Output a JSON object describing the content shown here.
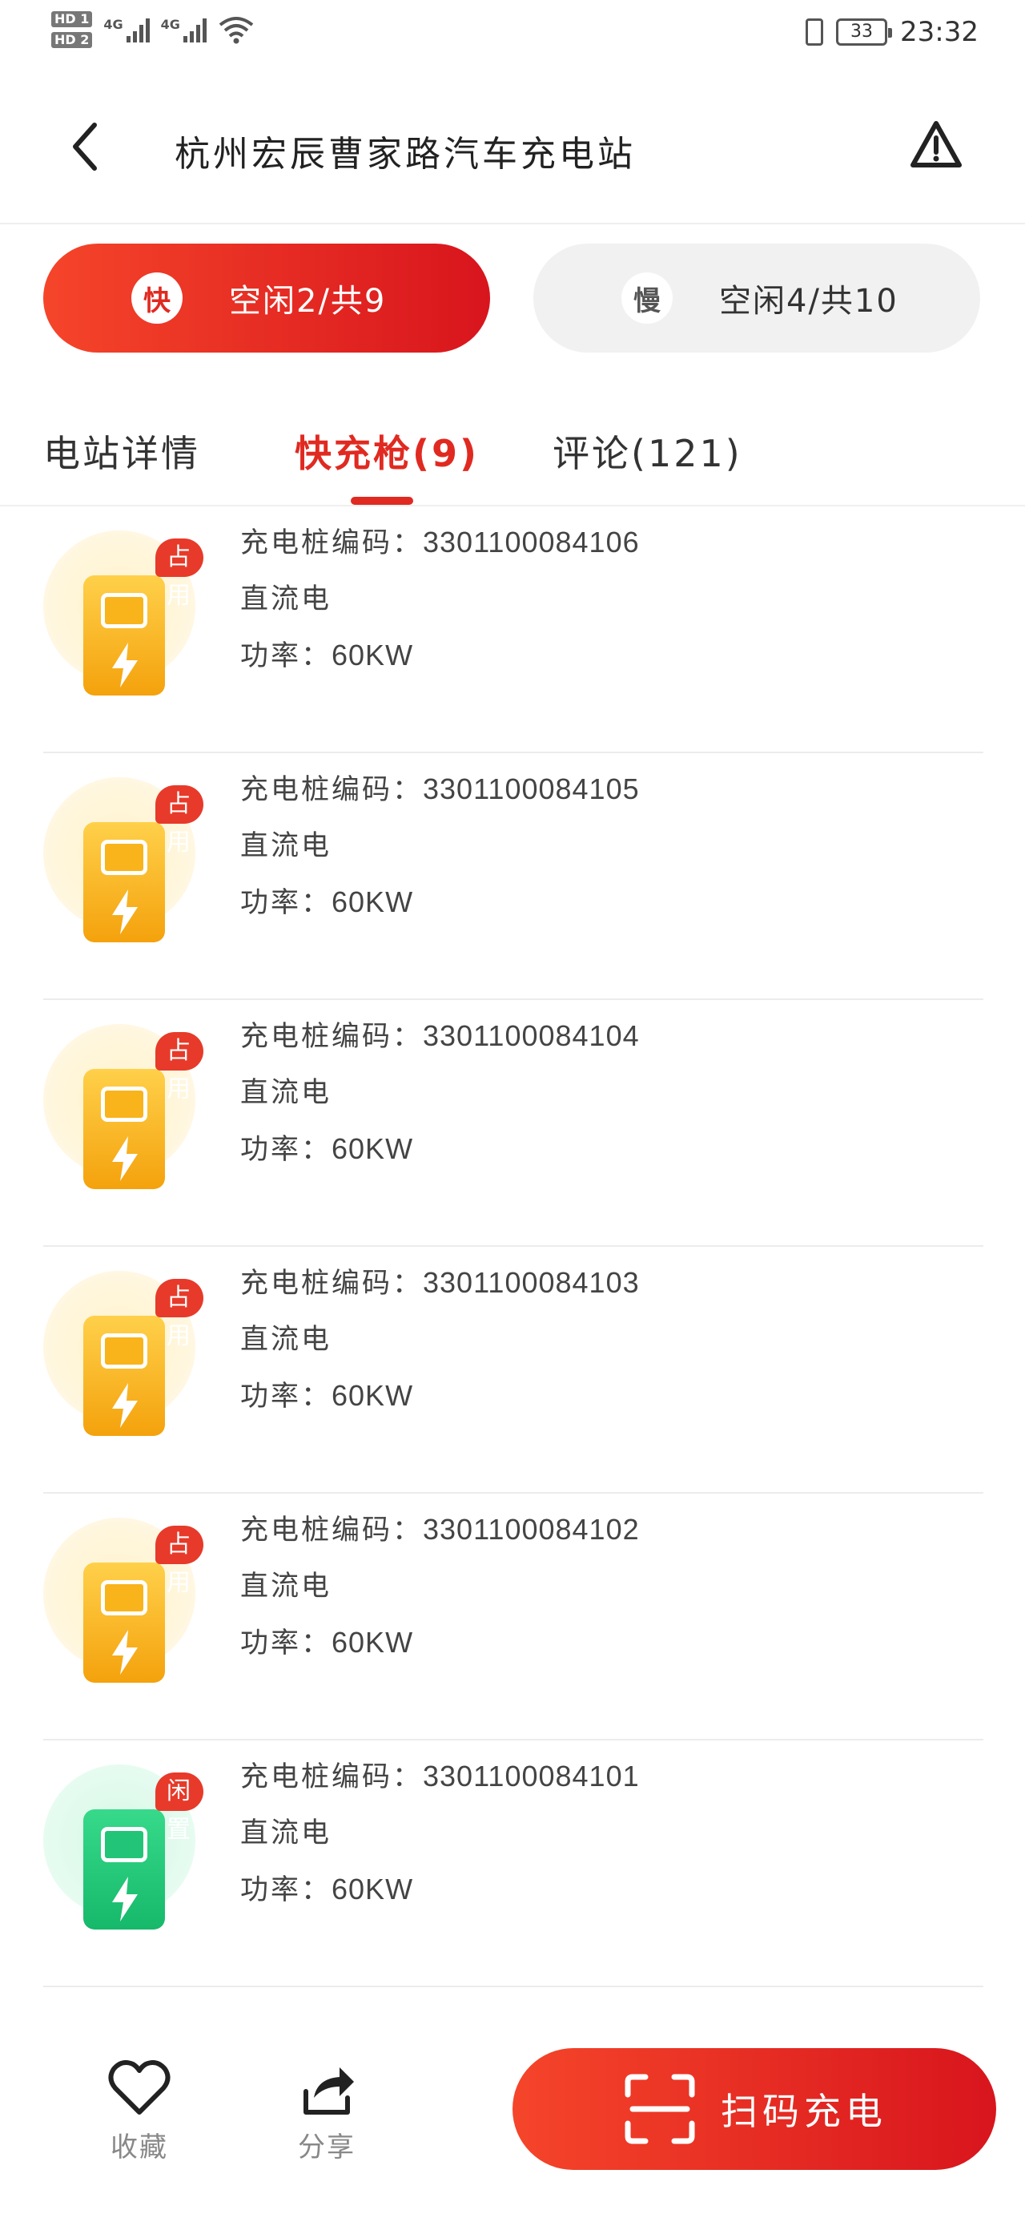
{
  "status_bar": {
    "time": "23:32",
    "battery": "33",
    "sim1": "HD 1",
    "sim2": "HD 2",
    "net1": "4G",
    "net2": "4G"
  },
  "header": {
    "title": "杭州宏辰曹家路汽车充电站"
  },
  "toggle": {
    "fast": {
      "icon_char": "快",
      "label": "空闲2/共9"
    },
    "slow": {
      "icon_char": "慢",
      "label": "空闲4/共10"
    }
  },
  "tabs": [
    {
      "label": "电站详情"
    },
    {
      "label": "快充枪(9)"
    },
    {
      "label": "评论(121)"
    }
  ],
  "chargers": [
    {
      "status": "占用",
      "code_label": "充电桩编码：",
      "code": "3301100084106",
      "type": "直流电",
      "power_label": "功率：",
      "power": "60KW",
      "state": "busy"
    },
    {
      "status": "占用",
      "code_label": "充电桩编码：",
      "code": "3301100084105",
      "type": "直流电",
      "power_label": "功率：",
      "power": "60KW",
      "state": "busy"
    },
    {
      "status": "占用",
      "code_label": "充电桩编码：",
      "code": "3301100084104",
      "type": "直流电",
      "power_label": "功率：",
      "power": "60KW",
      "state": "busy"
    },
    {
      "status": "占用",
      "code_label": "充电桩编码：",
      "code": "3301100084103",
      "type": "直流电",
      "power_label": "功率：",
      "power": "60KW",
      "state": "busy"
    },
    {
      "status": "占用",
      "code_label": "充电桩编码：",
      "code": "3301100084102",
      "type": "直流电",
      "power_label": "功率：",
      "power": "60KW",
      "state": "busy"
    },
    {
      "status": "闲置",
      "code_label": "充电桩编码：",
      "code": "3301100084101",
      "type": "直流电",
      "power_label": "功率：",
      "power": "60KW",
      "state": "free"
    }
  ],
  "bottom_bar": {
    "favorite_label": "收藏",
    "share_label": "分享",
    "scan_label": "扫码充电"
  },
  "colors": {
    "accent": "#e02a21",
    "busy": "#f4a20c",
    "free": "#16b86a"
  }
}
